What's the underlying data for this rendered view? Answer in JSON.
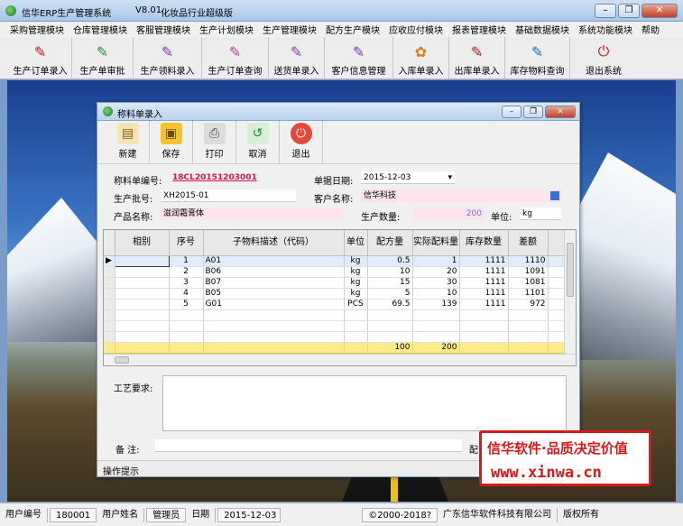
{
  "window": {
    "title": "信华ERP生产管理系统",
    "version": "V8.01",
    "edition": "化妆品行业超级版"
  },
  "menu": [
    "采购管理模块",
    "仓库管理模块",
    "客服管理模块",
    "生产计划模块",
    "生产管理模块",
    "配方生产模块",
    "应收应付模块",
    "报表管理模块",
    "基础数据模块",
    "系统功能模块",
    "帮助"
  ],
  "toolbar": [
    {
      "label": "生产订单录入",
      "icon": "pdf-doc-icon"
    },
    {
      "label": "生产单审批",
      "icon": "approve-doc-icon"
    },
    {
      "label": "生产领料录入",
      "icon": "pick-material-icon"
    },
    {
      "label": "生产订单查询",
      "icon": "query-order-icon"
    },
    {
      "label": "送货单录入",
      "icon": "delivery-doc-icon"
    },
    {
      "label": "客户信息管理",
      "icon": "customer-icon"
    },
    {
      "label": "入库单录入",
      "icon": "stock-in-icon"
    },
    {
      "label": "出库单录入",
      "icon": "stock-out-icon"
    },
    {
      "label": "库存物料查询",
      "icon": "inventory-icon"
    },
    {
      "label": "退出系统",
      "icon": "power-icon"
    }
  ],
  "dialog": {
    "title": "称料单录入",
    "tools": [
      {
        "label": "新建",
        "icon": "new-doc-icon"
      },
      {
        "label": "保存",
        "icon": "save-icon"
      },
      {
        "label": "打印",
        "icon": "print-icon"
      },
      {
        "label": "取消",
        "icon": "undo-icon"
      },
      {
        "label": "退出",
        "icon": "exit-icon"
      }
    ],
    "form": {
      "order_no_label": "称料单编号:",
      "order_no": "18CL20151203001",
      "date_label": "单据日期:",
      "date": "2015-12-03",
      "batch_label": "生产批号:",
      "batch": "XH2015-01",
      "customer_label": "客户名称:",
      "customer": "信华科技",
      "product_label": "产品名称:",
      "product": "滋润霜膏体",
      "qty_label": "生产数量:",
      "qty": "200",
      "unit_label": "单位:",
      "unit": "kg"
    },
    "grid": {
      "headers": [
        "相别",
        "序号",
        "子物料描述（代码）",
        "单位",
        "配方量",
        "实际配料量",
        "库存数量",
        "差额"
      ],
      "rows": [
        {
          "group": "",
          "seq": "1",
          "desc": "A01",
          "unit": "kg",
          "formula": "0.5",
          "actual": "1",
          "stock": "1111",
          "diff": "1110"
        },
        {
          "group": "",
          "seq": "2",
          "desc": "B06",
          "unit": "kg",
          "formula": "10",
          "actual": "20",
          "stock": "1111",
          "diff": "1091"
        },
        {
          "group": "",
          "seq": "3",
          "desc": "B07",
          "unit": "kg",
          "formula": "15",
          "actual": "30",
          "stock": "1111",
          "diff": "1081"
        },
        {
          "group": "",
          "seq": "4",
          "desc": "B05",
          "unit": "kg",
          "formula": "5",
          "actual": "10",
          "stock": "1111",
          "diff": "1101"
        },
        {
          "group": "",
          "seq": "5",
          "desc": "G01",
          "unit": "PCS",
          "formula": "69.5",
          "actual": "139",
          "stock": "1111",
          "diff": "972"
        }
      ],
      "totals": {
        "formula": "100",
        "actual": "200"
      }
    },
    "req_label": "工艺要求:",
    "note_label": "备  注:",
    "status": "操作提示"
  },
  "promo": {
    "line1": "信华软件·品质决定价值",
    "line2": "www.xinwa.cn"
  },
  "statusbar": {
    "user_no_label": "用户编号",
    "user_no": "180001",
    "user_name_label": "用户姓名",
    "user_name": "管理员",
    "date_label": "日期",
    "date": "2015-12-03",
    "copyright": "©2000-2018?",
    "company": "广东信华软件科技有限公司",
    "rights": "版权所有"
  },
  "colors": {
    "highlight": "#d4145a",
    "accent": "#d7191c",
    "total_row": "#ffeb8a"
  }
}
